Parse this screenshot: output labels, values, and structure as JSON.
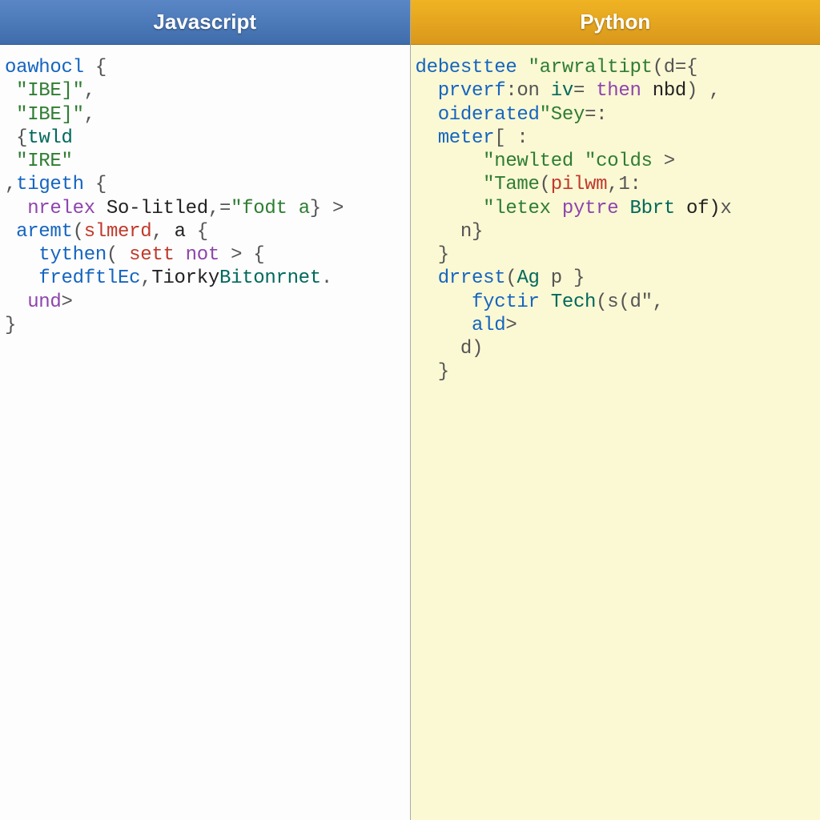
{
  "colors": {
    "js_header": "#4a78b5",
    "py_header": "#e2a21e",
    "py_bg": "#fbf8d4"
  },
  "left": {
    "title": "Javascript",
    "lines": [
      [
        {
          "t": "oawhocl",
          "c": "fn"
        },
        {
          "t": " {",
          "c": "op"
        }
      ],
      [
        {
          "t": " \"IBE]\"",
          "c": "str"
        },
        {
          "t": ",",
          "c": "op"
        }
      ],
      [
        {
          "t": " \"IBE]\"",
          "c": "str"
        },
        {
          "t": ",",
          "c": "op"
        }
      ],
      [
        {
          "t": " {",
          "c": "op"
        },
        {
          "t": "twld",
          "c": "prop"
        }
      ],
      [
        {
          "t": " \"IRE\"",
          "c": "str"
        }
      ],
      [
        {
          "t": ",",
          "c": "op"
        },
        {
          "t": "tigeth",
          "c": "fn"
        },
        {
          "t": " {",
          "c": "op"
        }
      ],
      [
        {
          "t": "  nrelex",
          "c": "kw"
        },
        {
          "t": " So-litled",
          "c": ""
        },
        {
          "t": ",=",
          "c": "op"
        },
        {
          "t": "\"fodt a",
          "c": "str"
        },
        {
          "t": "} >",
          "c": "op"
        }
      ],
      [
        {
          "t": "",
          "c": ""
        }
      ],
      [
        {
          "t": " aremt",
          "c": "fn"
        },
        {
          "t": "(",
          "c": "op"
        },
        {
          "t": "slmerd",
          "c": "id"
        },
        {
          "t": ", ",
          "c": "op"
        },
        {
          "t": "a",
          "c": ""
        },
        {
          "t": " {",
          "c": "op"
        }
      ],
      [
        {
          "t": "   tythen",
          "c": "fn"
        },
        {
          "t": "( ",
          "c": "op"
        },
        {
          "t": "sett",
          "c": "id"
        },
        {
          "t": " not",
          "c": "kw"
        },
        {
          "t": " > {",
          "c": "op"
        }
      ],
      [
        {
          "t": "   fredftlEc",
          "c": "fn"
        },
        {
          "t": ",",
          "c": "op"
        },
        {
          "t": "Tiorky",
          "c": ""
        },
        {
          "t": "Bitonrnet",
          "c": "prop"
        },
        {
          "t": ".",
          "c": "op"
        }
      ],
      [
        {
          "t": "  und",
          "c": "kw"
        },
        {
          "t": ">",
          "c": "op"
        }
      ],
      [
        {
          "t": "}",
          "c": "op"
        }
      ]
    ]
  },
  "right": {
    "title": "Python",
    "lines": [
      [
        {
          "t": "debesttee ",
          "c": "fn"
        },
        {
          "t": "\"arwraltipt",
          "c": "str"
        },
        {
          "t": "(d={",
          "c": "op"
        }
      ],
      [
        {
          "t": "  prverf",
          "c": "fn"
        },
        {
          "t": ":on ",
          "c": "op"
        },
        {
          "t": "iv",
          "c": "prop"
        },
        {
          "t": "= ",
          "c": "op"
        },
        {
          "t": "then",
          "c": "kw"
        },
        {
          "t": " nbd",
          "c": ""
        },
        {
          "t": ") ,",
          "c": "op"
        }
      ],
      [
        {
          "t": "  oiderated",
          "c": "fn"
        },
        {
          "t": "\"Sey",
          "c": "str"
        },
        {
          "t": "=:",
          "c": "op"
        }
      ],
      [
        {
          "t": "  meter",
          "c": "fn"
        },
        {
          "t": "[ :",
          "c": "op"
        }
      ],
      [
        {
          "t": "      \"newlted ",
          "c": "str"
        },
        {
          "t": "\"colds ",
          "c": "str"
        },
        {
          "t": ">",
          "c": "op"
        }
      ],
      [
        {
          "t": "      \"Tame",
          "c": "str"
        },
        {
          "t": "(",
          "c": "op"
        },
        {
          "t": "pilwm",
          "c": "id"
        },
        {
          "t": ",1:",
          "c": "op"
        }
      ],
      [
        {
          "t": "      \"letex ",
          "c": "str"
        },
        {
          "t": "pytre ",
          "c": "kw"
        },
        {
          "t": "Bbrt",
          "c": "prop"
        },
        {
          "t": " of)",
          "c": ""
        },
        {
          "t": "x",
          "c": "op"
        }
      ],
      [
        {
          "t": "    n}",
          "c": "op"
        }
      ],
      [
        {
          "t": "  }",
          "c": "op"
        }
      ],
      [
        {
          "t": "",
          "c": ""
        }
      ],
      [
        {
          "t": "  drrest",
          "c": "fn"
        },
        {
          "t": "(",
          "c": "op"
        },
        {
          "t": "Ag",
          "c": "prop"
        },
        {
          "t": " p }",
          "c": "op"
        }
      ],
      [
        {
          "t": "     fyctir ",
          "c": "fn"
        },
        {
          "t": "Tech",
          "c": "prop"
        },
        {
          "t": "(s(d\",",
          "c": "op"
        }
      ],
      [
        {
          "t": "     ald",
          "c": "fn"
        },
        {
          "t": ">",
          "c": "op"
        }
      ],
      [
        {
          "t": "    d)",
          "c": "op"
        }
      ],
      [
        {
          "t": "  }",
          "c": "op"
        }
      ]
    ]
  }
}
